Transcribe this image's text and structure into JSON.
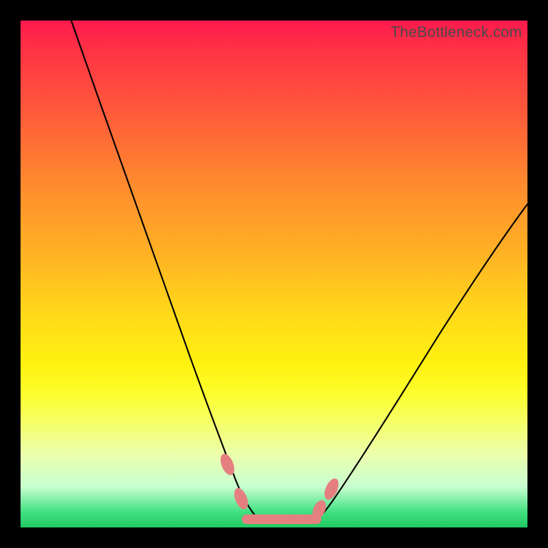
{
  "watermark": "TheBottleneck.com",
  "colors": {
    "frame": "#000000",
    "marker": "#e58080",
    "curve": "#000000"
  },
  "chart_data": {
    "type": "line",
    "title": "",
    "xlabel": "",
    "ylabel": "",
    "xlim": [
      0,
      100
    ],
    "ylim": [
      0,
      100
    ],
    "grid": false,
    "legend": false,
    "series": [
      {
        "name": "left-curve",
        "x": [
          10,
          15,
          20,
          25,
          30,
          35,
          38,
          40,
          42,
          44,
          46,
          48
        ],
        "y": [
          100,
          84,
          68,
          52,
          38,
          24,
          16,
          12,
          8,
          5,
          3,
          2
        ]
      },
      {
        "name": "right-curve",
        "x": [
          58,
          60,
          64,
          70,
          76,
          82,
          88,
          94,
          100
        ],
        "y": [
          2,
          4,
          10,
          20,
          30,
          40,
          49,
          57,
          64
        ]
      },
      {
        "name": "bottleneck-flat",
        "x": [
          44,
          46,
          48,
          50,
          52,
          54,
          56,
          58
        ],
        "y": [
          2,
          2,
          2,
          2,
          2,
          2,
          2,
          2
        ]
      }
    ],
    "markers": [
      {
        "name": "left-dot-upper",
        "x": 40,
        "y": 12
      },
      {
        "name": "left-dot-lower",
        "x": 42,
        "y": 6
      },
      {
        "name": "right-dot-upper",
        "x": 60,
        "y": 8
      },
      {
        "name": "right-dot-lower",
        "x": 58,
        "y": 4
      }
    ]
  }
}
